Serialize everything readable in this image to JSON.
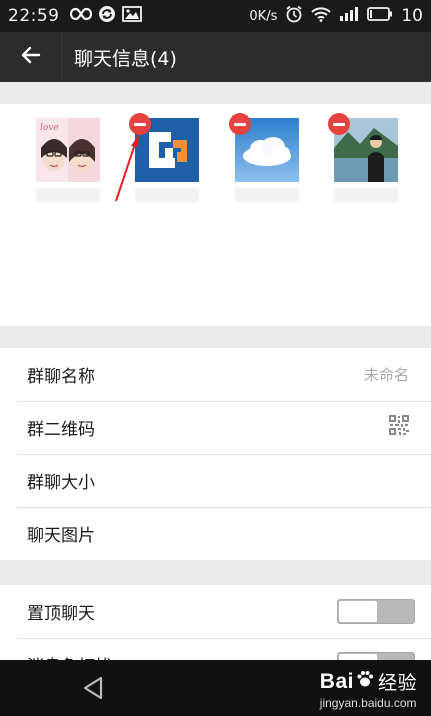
{
  "status_bar": {
    "time": "22:59",
    "net_speed": "0K/s",
    "battery": "10"
  },
  "nav": {
    "title": "聊天信息(4)"
  },
  "members": [
    {
      "avatar": "girl-photo"
    },
    {
      "avatar": "logo-blue-orange"
    },
    {
      "avatar": "cloud-sky"
    },
    {
      "avatar": "man-mountain-lake"
    }
  ],
  "settings_group_1": [
    {
      "label": "群聊名称",
      "value": "未命名"
    },
    {
      "label": "群二维码",
      "icon": "qr-code-icon"
    },
    {
      "label": "群聊大小"
    },
    {
      "label": "聊天图片"
    }
  ],
  "settings_group_2": [
    {
      "label": "置顶聊天",
      "toggle": "off"
    },
    {
      "label": "消息免打扰",
      "toggle": "off"
    }
  ],
  "watermark": {
    "brand_left": "Bai",
    "brand_right": "经验",
    "url": "jingyan.baidu.com"
  },
  "colors": {
    "nav_bg": "#2c2c2c",
    "status_bg": "#1a1a1a",
    "remove_badge": "#e64340",
    "annotation_arrow": "#e02020"
  }
}
